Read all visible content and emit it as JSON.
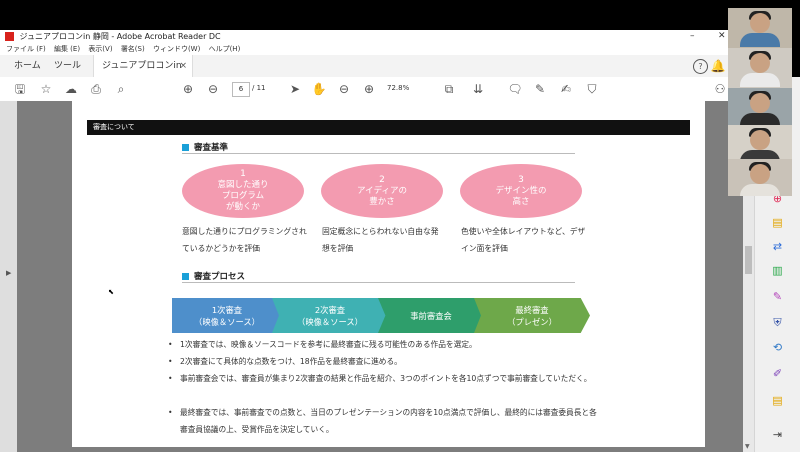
{
  "window": {
    "title": "ジュニアプロコンin 静岡 - Adobe Acrobat Reader DC",
    "controls": {
      "minimize": "–",
      "close": "✕"
    }
  },
  "menu": [
    "ファイル (F)",
    "編集 (E)",
    "表示(V)",
    "署名(S)",
    "ウィンドウ(W)",
    "ヘルプ(H)"
  ],
  "tabs": {
    "home": "ホーム",
    "tools": "ツール",
    "document": "ジュニアプロコンin ...",
    "close": "×"
  },
  "toolbar": {
    "page_current": "6",
    "page_total": "/ 11",
    "zoom": "72.8%"
  },
  "document": {
    "header": "審査について",
    "criteria_title": "審査基準",
    "criteria": [
      {
        "num": "1",
        "line1": "意図した通り",
        "line2": "プログラム",
        "line3": "が動くか",
        "desc": "意図した通りにプログラミングされているかどうかを評価"
      },
      {
        "num": "2",
        "line1": "アイディアの",
        "line2": "豊かさ",
        "line3": "",
        "desc": "固定概念にとらわれない自由な発想を評価"
      },
      {
        "num": "3",
        "line1": "デザイン性の",
        "line2": "高さ",
        "line3": "",
        "desc": "色使いや全体レイアウトなど、デザイン面を評価"
      }
    ],
    "process_title": "審査プロセス",
    "steps": [
      {
        "line1": "1次審査",
        "line2": "（映像＆ソース）",
        "color": "#4e8fcb"
      },
      {
        "line1": "2次審査",
        "line2": "（映像＆ソース）",
        "color": "#3fb1b3"
      },
      {
        "line1": "事前審査会",
        "line2": "",
        "color": "#2e9e6b"
      },
      {
        "line1": "最終審査",
        "line2": "（プレゼン）",
        "color": "#6ea84a"
      }
    ],
    "bullets": [
      {
        "text": "1次審査では、映像＆ソースコードを参考に最終審査に残る可能性のある作品を選定。"
      },
      {
        "text": "2次審査にて具体的な点数をつけ、18作品を最終審査に進める。"
      },
      {
        "text": "事前審査会では、審査員が集まり2次審査の結果と作品を紹介、3つのポイントを各10点ずつで事前審査していただく。"
      },
      {
        "text": "最終審査では、事前審査での点数と、当日のプレゼンテーションの内容を10点満点で評価し、最終的には審査委員長と各審査員協議の上、受賞作品を決定していく。"
      }
    ]
  },
  "icons": {
    "save": "save-icon",
    "star": "star-icon",
    "upload": "cloud-upload-icon",
    "print": "print-icon",
    "search": "search-icon",
    "help": "help-icon",
    "bell": "bell-icon",
    "sign_in": "sign-in-icon"
  }
}
